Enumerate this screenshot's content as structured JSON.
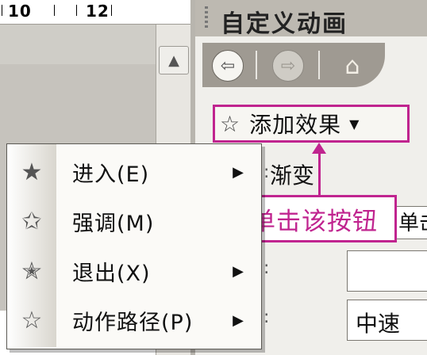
{
  "ruler": {
    "labels": [
      "10",
      "12"
    ]
  },
  "task_pane": {
    "title": "自定义动画",
    "nav": {
      "back_icon": "back-arrow-icon",
      "forward_icon": "forward-arrow-icon",
      "home_icon": "home-icon"
    },
    "add_effect": {
      "label": "添加效果",
      "icon": "star-icon",
      "arrow": "▼"
    },
    "modify_label": "渐变",
    "start_value_partial": "单击",
    "speed_value": "中速"
  },
  "callout": {
    "text": "单击该按钮",
    "color": "#c0248f"
  },
  "menu": {
    "items": [
      {
        "label": "进入(E)",
        "icon": "entrance-star-icon",
        "submenu": true
      },
      {
        "label": "强调(M)",
        "icon": "emphasis-star-icon",
        "submenu": false
      },
      {
        "label": "退出(X)",
        "icon": "exit-star-icon",
        "submenu": true
      },
      {
        "label": "动作路径(P)",
        "icon": "motion-path-star-icon",
        "submenu": true
      }
    ]
  }
}
